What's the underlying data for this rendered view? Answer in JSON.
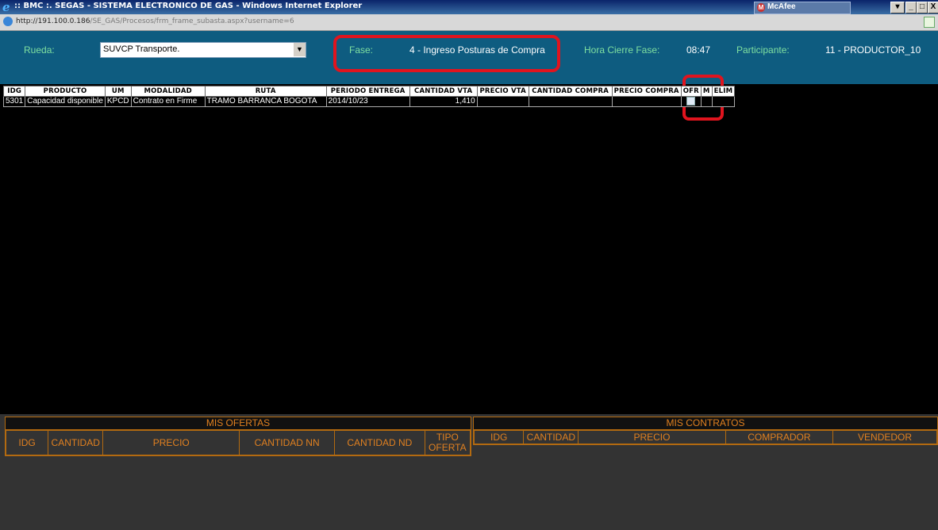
{
  "window": {
    "title": ":: BMC :. SEGAS - SISTEMA ELECTRONICO DE GAS - Windows Internet Explorer",
    "mcafee": "McAfee",
    "url_host": "http://191.100.0.186",
    "url_path": "/SE_GAS/Procesos/frm_frame_subasta.aspx?username=6",
    "min_label": "_",
    "max_label": "□",
    "close_label": "X"
  },
  "header": {
    "rueda_label": "Rueda:",
    "rueda_value": "SUVCP Transporte.",
    "fase_label": "Fase:",
    "fase_value": "4 - Ingreso Posturas de Compra",
    "hora_label": "Hora Cierre Fase:",
    "hora_value": "08:47",
    "participante_label": "Participante:",
    "participante_value": "11 - PRODUCTOR_10"
  },
  "grid": {
    "headers": [
      "IDG",
      "PRODUCTO",
      "UM",
      "MODALIDAD",
      "RUTA",
      "PERIODO ENTREGA",
      "CANTIDAD VTA",
      "PRECIO VTA",
      "CANTIDAD COMPRA",
      "PRECIO COMPRA",
      "OFR",
      "M",
      "ELIM"
    ],
    "row": {
      "idg": "5301",
      "producto": "Capacidad disponible",
      "um": "KPCD",
      "modalidad": "Contrato en Firme",
      "ruta": "TRAMO BARRANCA BOGOTA",
      "periodo": "2014/10/23",
      "cantidad_vta": "1,410",
      "precio_vta": "",
      "cantidad_compra": "",
      "precio_compra": ""
    }
  },
  "mis_ofertas": {
    "title": "MIS OFERTAS",
    "headers": [
      "IDG",
      "CANTIDAD",
      "PRECIO",
      "CANTIDAD NN",
      "CANTIDAD ND",
      "TIPO OFERTA"
    ]
  },
  "mis_contratos": {
    "title": "MIS CONTRATOS",
    "headers": [
      "IDG",
      "CANTIDAD",
      "PRECIO",
      "COMPRADOR",
      "VENDEDOR"
    ]
  },
  "colors": {
    "header_bg": "#0e5c80",
    "label_green": "#7fe0a0",
    "highlight_red": "#e0141e",
    "orange": "#e08020"
  }
}
